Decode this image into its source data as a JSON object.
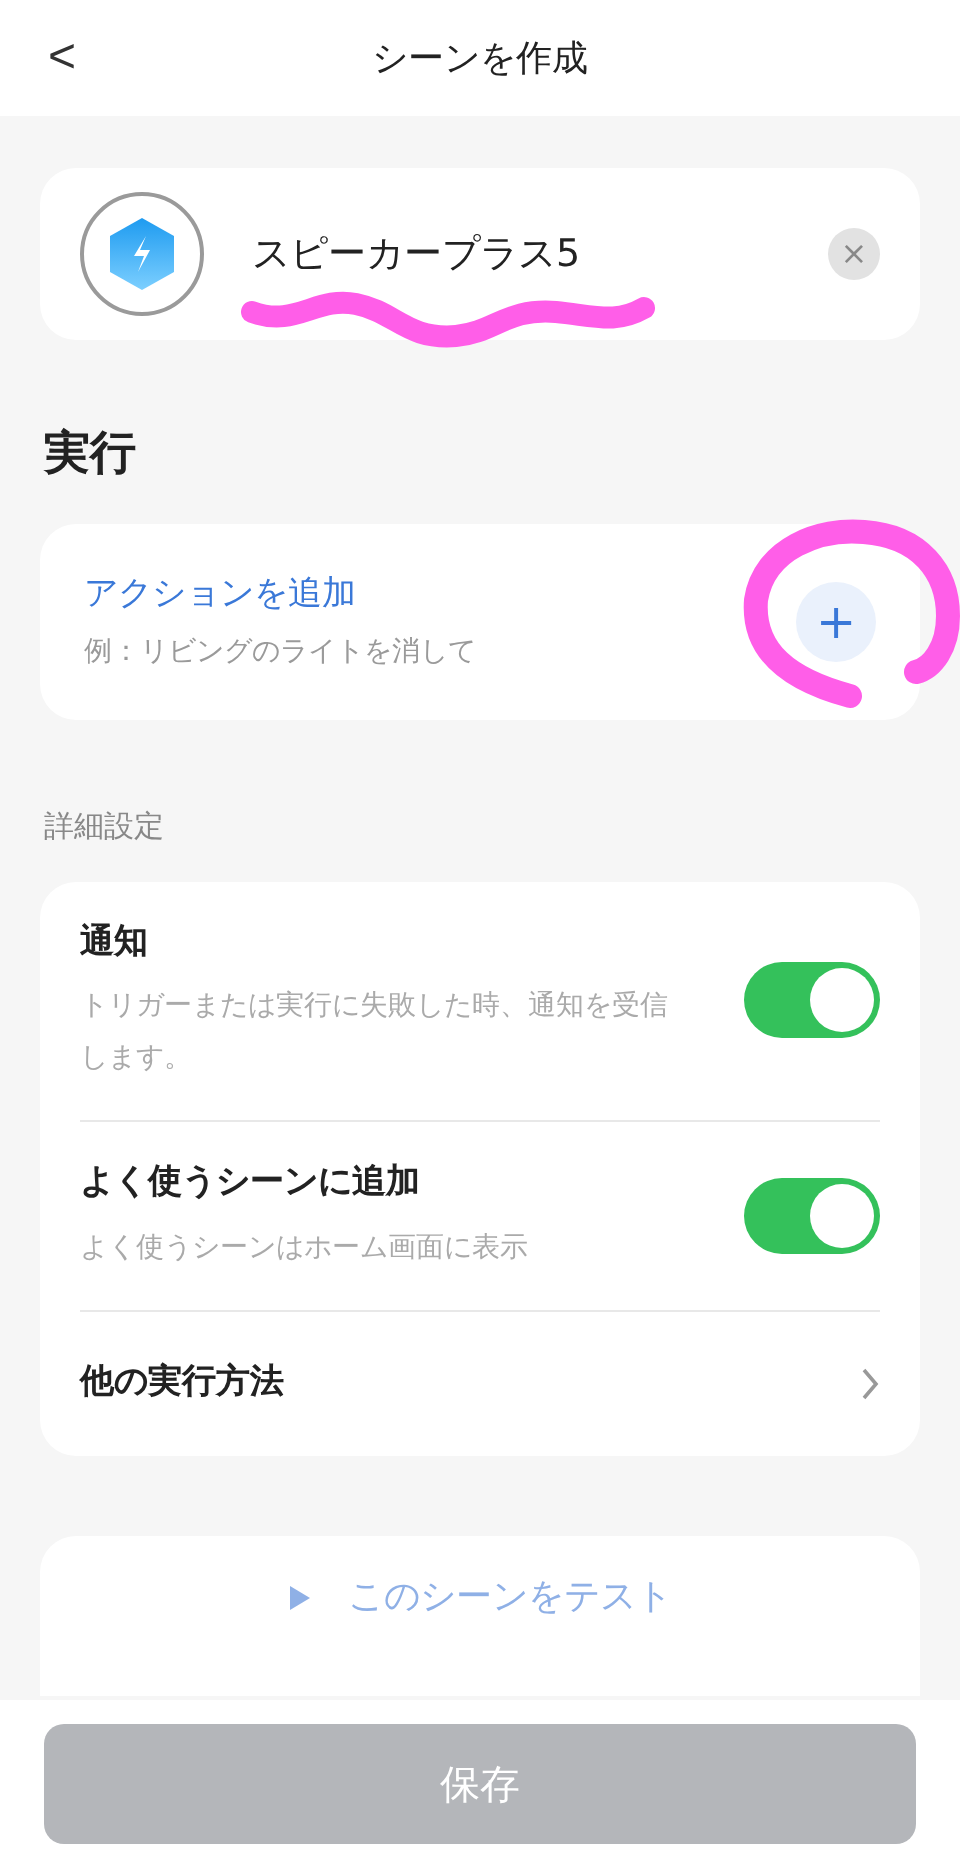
{
  "header": {
    "back": "<",
    "title": "シーンを作成"
  },
  "scene": {
    "name": "スピーカープラス5",
    "clear": "×"
  },
  "run_section": {
    "title": "実行",
    "action": {
      "title": "アクションを追加",
      "hint": "例：リビングのライトを消して",
      "add": "+"
    }
  },
  "advanced": {
    "title": "詳細設定",
    "rows": [
      {
        "kind": "toggle",
        "title": "通知",
        "description": "トリガーまたは実行に失敗した時、通知を受信します。",
        "on": true
      },
      {
        "kind": "toggle",
        "title": "よく使うシーンに追加",
        "description": "よく使うシーンはホーム画面に表示",
        "on": true
      },
      {
        "kind": "link",
        "title": "他の実行方法"
      }
    ]
  },
  "test_button": {
    "label": "このシーンをテスト",
    "disabled": true
  },
  "save_button": {
    "label": "保存",
    "disabled": true
  },
  "annotations": [
    {
      "kind": "scribble"
    },
    {
      "kind": "circle"
    }
  ]
}
